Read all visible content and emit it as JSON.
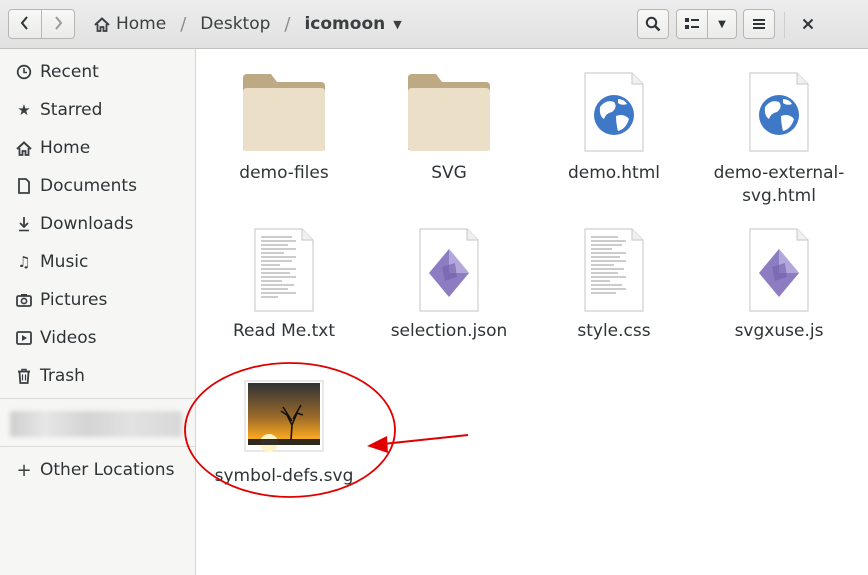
{
  "header": {
    "back_icon": "chevron-left-icon",
    "forward_icon": "chevron-right-icon",
    "breadcrumb": [
      {
        "label": "Home",
        "icon": "home-icon"
      },
      {
        "label": "Desktop"
      },
      {
        "label": "icomoon",
        "current": true
      }
    ],
    "search_icon": "search-icon",
    "view_icon": "list-view-icon",
    "dropdown_icon": "chevron-down-icon",
    "menu_icon": "hamburger-menu-icon",
    "close_icon": "close-icon"
  },
  "sidebar": {
    "items": [
      {
        "label": "Recent",
        "icon": "clock-icon"
      },
      {
        "label": "Starred",
        "icon": "star-icon"
      },
      {
        "label": "Home",
        "icon": "home-icon"
      },
      {
        "label": "Documents",
        "icon": "document-icon"
      },
      {
        "label": "Downloads",
        "icon": "download-icon"
      },
      {
        "label": "Music",
        "icon": "music-icon"
      },
      {
        "label": "Pictures",
        "icon": "camera-icon"
      },
      {
        "label": "Videos",
        "icon": "video-icon"
      },
      {
        "label": "Trash",
        "icon": "trash-icon"
      }
    ],
    "other_locations": {
      "label": "Other Locations",
      "icon": "plus-icon"
    }
  },
  "files": [
    {
      "name": "demo-files",
      "type": "folder"
    },
    {
      "name": "SVG",
      "type": "folder"
    },
    {
      "name": "demo.html",
      "type": "html"
    },
    {
      "name": "demo-external-svg.html",
      "type": "html"
    },
    {
      "name": "Read Me.txt",
      "type": "text"
    },
    {
      "name": "selection.json",
      "type": "script"
    },
    {
      "name": "style.css",
      "type": "text"
    },
    {
      "name": "svgxuse.js",
      "type": "script"
    },
    {
      "name": "symbol-defs.svg",
      "type": "image"
    }
  ],
  "colors": {
    "annotation": "#e00000",
    "folder": "#d6c29f",
    "script_icon": "#8e7cc3"
  }
}
